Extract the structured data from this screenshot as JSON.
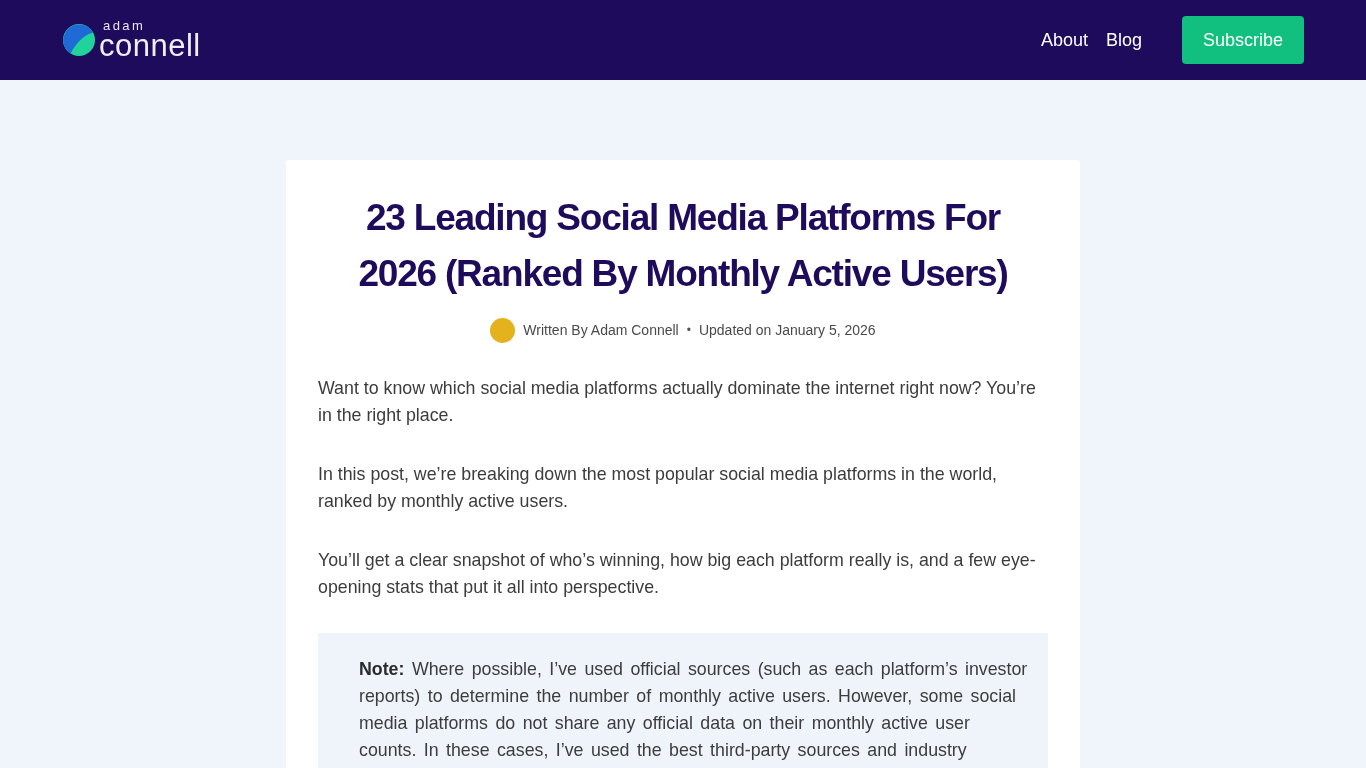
{
  "header": {
    "logo": {
      "top": "adam",
      "bottom": "connell"
    },
    "nav": [
      {
        "label": "About"
      },
      {
        "label": "Blog"
      }
    ],
    "button": "Subscribe"
  },
  "article": {
    "title": "23 Leading Social Media Platforms For 2026 (Ranked By Monthly Active Users)",
    "byline": {
      "author": "Written By Adam Connell",
      "separator": "•",
      "updated": "Updated on January 5, 2026"
    },
    "paragraphs": [
      "Want to know which social media platforms actually dominate the internet right now? You’re in the right place.",
      "In this post, we’re breaking down the most popular social media platforms in the world, ranked by monthly active users.",
      "You’ll get a clear snapshot of who’s winning, how big each platform really is, and a few eye-opening stats that put it all into perspective."
    ],
    "note": "**Note:** Where possible, I’ve used official sources (such as each platform’s investor reports) to determine the number of monthly active users. However, some social media platforms do not share any official data on their monthly active user counts. In these cases, I’ve used the best third-party sources and industry"
  }
}
